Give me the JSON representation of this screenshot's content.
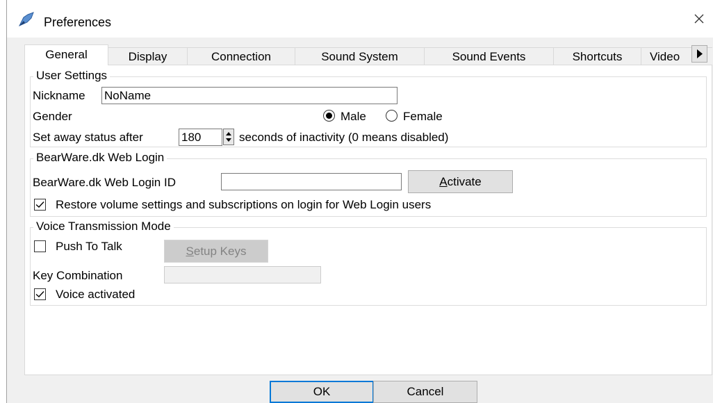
{
  "window": {
    "title": "Preferences"
  },
  "tabs": [
    "General",
    "Display",
    "Connection",
    "Sound System",
    "Sound Events",
    "Shortcuts",
    "Video"
  ],
  "user_settings": {
    "title": "User Settings",
    "nickname_label": "Nickname",
    "nickname_value": "NoName",
    "gender_label": "Gender",
    "gender_options": [
      "Male",
      "Female"
    ],
    "gender_selected": "Male",
    "away_prefix": "Set away status after",
    "away_value": "180",
    "away_suffix": "seconds of inactivity (0 means disabled)"
  },
  "web_login": {
    "title": "BearWare.dk Web Login",
    "id_label": "BearWare.dk Web Login ID",
    "id_value": "",
    "activate_first": "A",
    "activate_rest": "ctivate",
    "restore_label": "Restore volume settings and subscriptions on login for Web Login users",
    "restore_checked": true
  },
  "voice": {
    "title": "Voice Transmission Mode",
    "ptt_label": "Push To Talk",
    "ptt_checked": false,
    "setup_first": "S",
    "setup_rest": "etup Keys",
    "keycombo_label": "Key Combination",
    "keycombo_value": "",
    "voice_activated_label": "Voice activated",
    "voice_activated_checked": true
  },
  "footer": {
    "ok": "OK",
    "cancel": "Cancel"
  },
  "icons": {
    "app": "app-icon",
    "close": "close-icon",
    "scroll": "tab-scroll-right-icon"
  },
  "colors": {
    "accent": "#0078d7"
  }
}
